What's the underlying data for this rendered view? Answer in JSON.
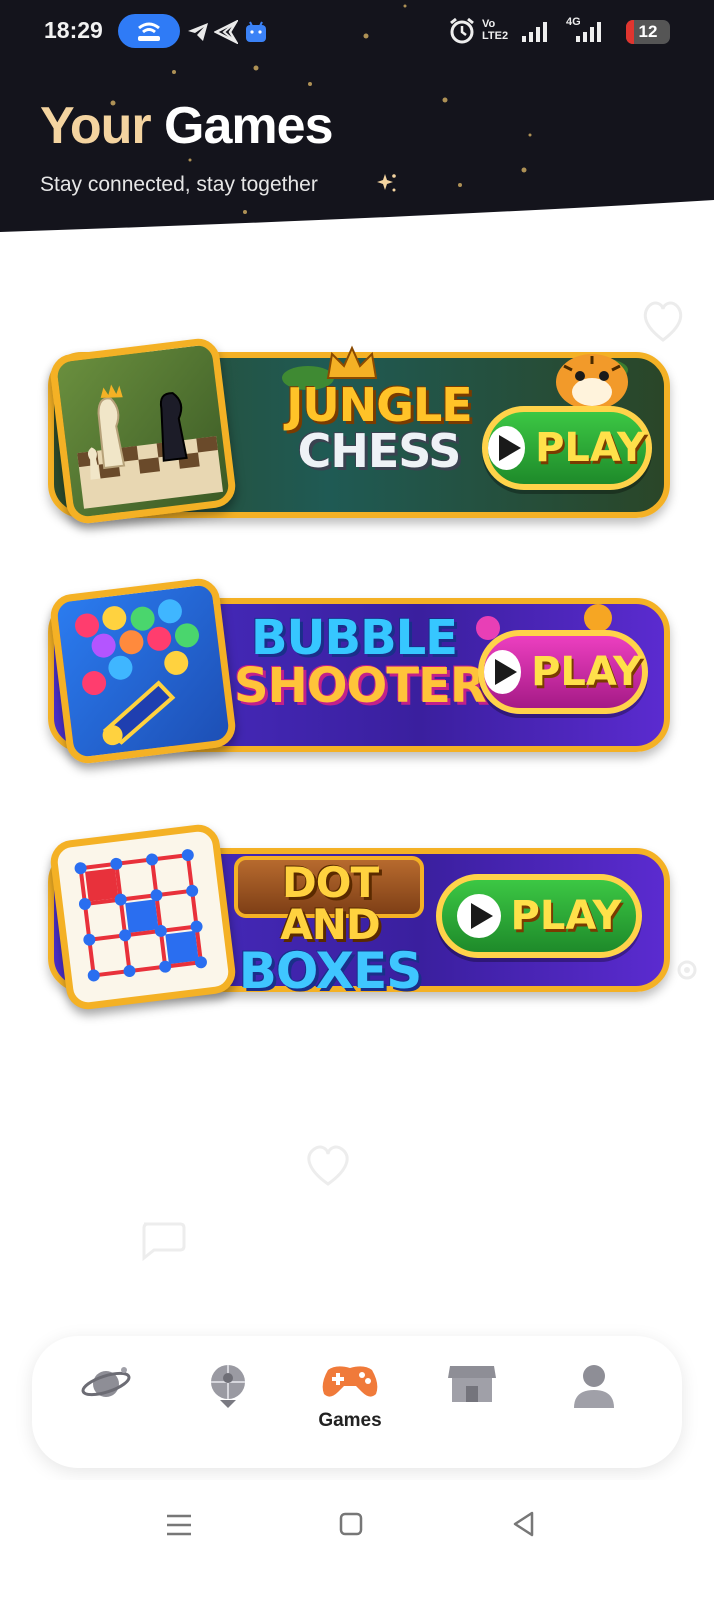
{
  "status_bar": {
    "time": "18:29",
    "network_label": "Vo LTE2",
    "signal_label": "4G",
    "battery": "12",
    "icons": [
      "hotspot-icon",
      "telegram-icon",
      "send-icon",
      "android-icon",
      "alarm-icon",
      "volte-icon",
      "signal-icon",
      "signal-4g-icon",
      "battery-icon"
    ]
  },
  "header": {
    "title_part1": "Your",
    "title_part2": "Games",
    "subtitle": "Stay connected, stay together",
    "sparkle_icon": "sparkle-icon"
  },
  "games": [
    {
      "title_line1": "JUNGLE",
      "title_line2": "CHESS",
      "play_label": "PLAY",
      "thumb_icon": "chess-pieces-icon",
      "accent": "#2f5d2a"
    },
    {
      "title_line1": "BUBBLE",
      "title_line2": "SHOOTER",
      "play_label": "PLAY",
      "thumb_icon": "bubble-cannon-icon",
      "accent": "#4a1fb8"
    },
    {
      "title_line1": "DOT AND",
      "title_line2": "BOXES",
      "play_label": "PLAY",
      "thumb_icon": "dot-grid-icon",
      "accent": "#4a1fb8"
    }
  ],
  "bottom_nav": {
    "items": [
      {
        "icon": "planet-icon",
        "label": ""
      },
      {
        "icon": "globe-pin-icon",
        "label": ""
      },
      {
        "icon": "gamepad-icon",
        "label": "Games"
      },
      {
        "icon": "store-icon",
        "label": ""
      },
      {
        "icon": "profile-icon",
        "label": ""
      }
    ],
    "active_index": 2
  },
  "system_nav": {
    "icons": [
      "menu-icon",
      "home-icon",
      "back-icon"
    ]
  },
  "colors": {
    "header_bg": "#14141c",
    "accent_gold": "#f4b125",
    "play_green": "#2fa53a",
    "play_magenta": "#d02aa8"
  }
}
